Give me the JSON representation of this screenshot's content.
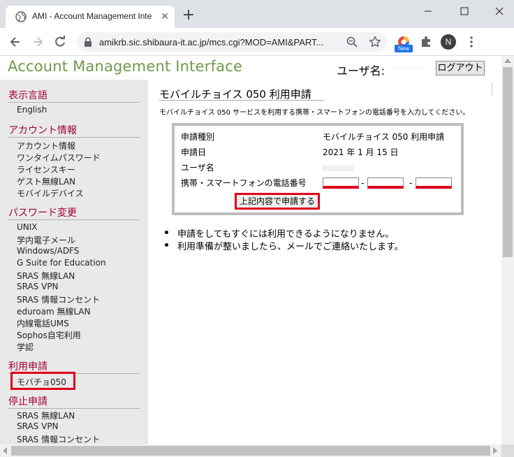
{
  "browser": {
    "tab_title": "AMI - Account Management Inte",
    "url": "amikrb.sic.shibaura-it.ac.jp/mcs.cgi?MOD=AMI&PART...",
    "new_badge": "New",
    "profile_initial": "N"
  },
  "header": {
    "app_title": "Account Management Interface",
    "user_label": "ユーザ名:",
    "logout_label": "ログアウト"
  },
  "sidebar": {
    "sections": [
      {
        "heading": "表示言語",
        "items": [
          "English"
        ]
      },
      {
        "heading": "アカウント情報",
        "items": [
          "アカウント情報",
          "ワンタイムパスワード",
          "ライセンスキー",
          "ゲスト無線LAN",
          "モバイルデバイス"
        ]
      },
      {
        "heading": "パスワード変更",
        "items": [
          "UNIX",
          "学内電子メール",
          "Windows/ADFS",
          "G Suite for Education",
          "SRAS 無線LAN",
          "SRAS VPN",
          "SRAS 情報コンセント",
          "eduroam 無線LAN",
          "内線電話UMS",
          "Sophos自宅利用",
          "学認"
        ]
      },
      {
        "heading": "利用申請",
        "items": [
          "モバチョ050"
        ]
      },
      {
        "heading": "停止申請",
        "items": [
          "SRAS 無線LAN",
          "SRAS VPN",
          "SRAS 情報コンセント"
        ]
      }
    ]
  },
  "main": {
    "title": "モバイルチョイス 050 利用申請",
    "description": "モバイルチョイス 050 サービスを利用する携帯・スマートフォンの電話番号を入力してください。",
    "form": {
      "rows": [
        {
          "label": "申請種別",
          "value": "モバイルチョイス 050 利用申請"
        },
        {
          "label": "申請日",
          "value": "2021 年 1 月 15 日"
        },
        {
          "label": "ユーザ名",
          "value": ""
        },
        {
          "label": "携帯・スマートフォンの電話番号",
          "value": ""
        }
      ],
      "phone_separator": "-",
      "phone_parts": [
        "",
        "",
        ""
      ],
      "submit_label": "上記内容で申請する"
    },
    "notes": [
      "申請をしてもすぐには利用できるようになりません。",
      "利用準備が整いましたら、メールでご連絡いたします。"
    ]
  },
  "colors": {
    "accent_red": "#e0001b",
    "section_heading": "#a0003a",
    "app_title_green": "#6f9a4a"
  }
}
